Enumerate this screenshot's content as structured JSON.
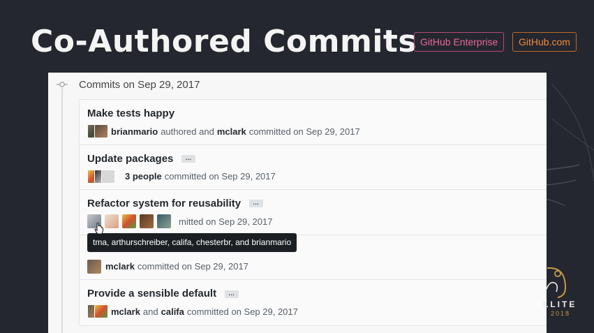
{
  "slide": {
    "title": "Co-Authored Commits",
    "badges": {
      "enterprise": "GitHub Enterprise",
      "dotcom": "GitHub.com"
    },
    "brand": {
      "name": "LLITE",
      "year": "2018",
      "accent": "#c59a4a"
    }
  },
  "timeline": {
    "group_header": "Commits on Sep 29, 2017",
    "commits": [
      {
        "title": "Make tests happy",
        "author": "brianmario",
        "authored_text": "authored and",
        "committer": "mclark",
        "committed_text": "committed on Sep 29, 2017"
      },
      {
        "title": "Update packages",
        "ellipsis": "…",
        "people": "3 people",
        "committed_text": "committed on Sep 29, 2017"
      },
      {
        "title": "Refactor system for reusability",
        "ellipsis": "…",
        "committed_text": "mitted on Sep 29, 2017"
      },
      {
        "committer": "mclark",
        "committed_text": "committed on Sep 29, 2017"
      },
      {
        "title": "Provide a sensible default",
        "ellipsis": "…",
        "author": "mclark",
        "and_text": "and",
        "coauthor": "califa",
        "committed_text": "committed on Sep 29, 2017"
      }
    ],
    "tooltip": "tma, arthurschreiber, califa, chesterbr, and brianmario"
  },
  "colors": {
    "background": "#24272f",
    "enterprise_badge": "#e9669a",
    "dotcom_badge": "#f08a3c"
  }
}
